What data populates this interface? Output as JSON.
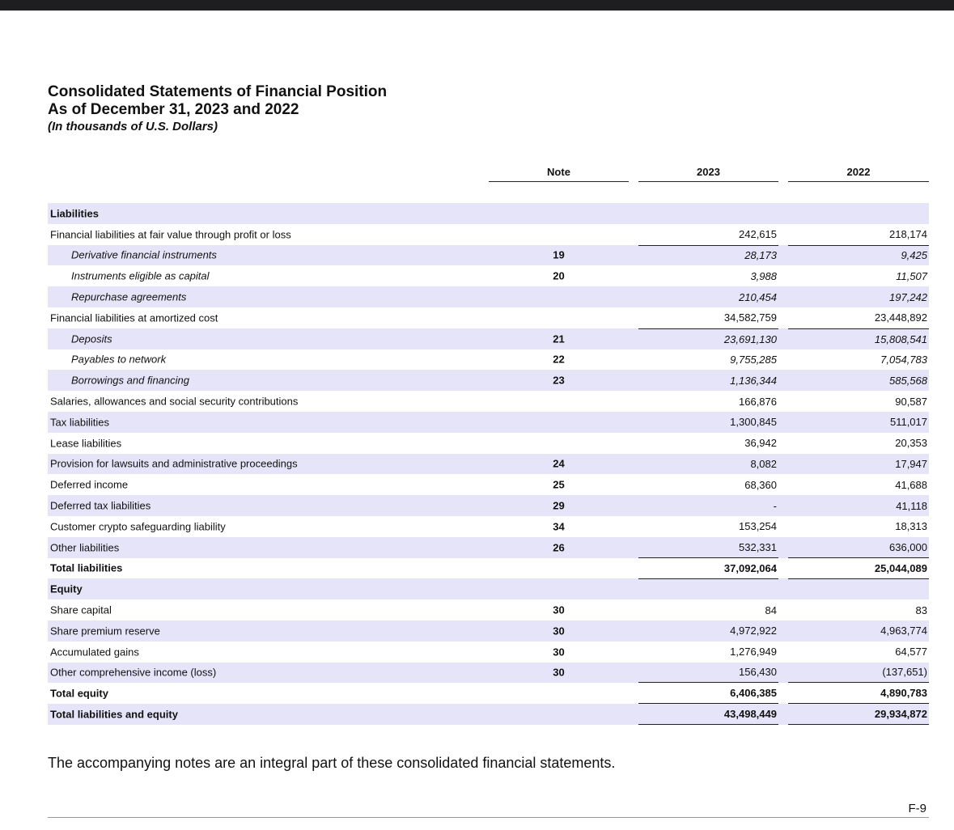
{
  "header": {
    "title": "Consolidated Statements of Financial Position",
    "subtitle": "As of December 31, 2023 and 2022",
    "units": "(In thousands of U.S. Dollars)"
  },
  "columns": {
    "note": "Note",
    "y2023": "2023",
    "y2022": "2022"
  },
  "rows": [
    {
      "label": "Liabilities",
      "note": "",
      "v2023": "",
      "v2022": ""
    },
    {
      "label": "Financial liabilities at fair value through profit or loss",
      "note": "",
      "v2023": "242,615",
      "v2022": "218,174"
    },
    {
      "label": "Derivative financial instruments",
      "note": "19",
      "v2023": "28,173",
      "v2022": "9,425"
    },
    {
      "label": "Instruments eligible as capital",
      "note": "20",
      "v2023": "3,988",
      "v2022": "11,507"
    },
    {
      "label": "Repurchase agreements",
      "note": "",
      "v2023": "210,454",
      "v2022": "197,242"
    },
    {
      "label": "Financial liabilities at amortized cost",
      "note": "",
      "v2023": "34,582,759",
      "v2022": "23,448,892"
    },
    {
      "label": "Deposits",
      "note": "21",
      "v2023": "23,691,130",
      "v2022": "15,808,541"
    },
    {
      "label": "Payables to network",
      "note": "22",
      "v2023": "9,755,285",
      "v2022": "7,054,783"
    },
    {
      "label": "Borrowings and financing",
      "note": "23",
      "v2023": "1,136,344",
      "v2022": "585,568"
    },
    {
      "label": "Salaries, allowances and social security contributions",
      "note": "",
      "v2023": "166,876",
      "v2022": "90,587"
    },
    {
      "label": "Tax liabilities",
      "note": "",
      "v2023": "1,300,845",
      "v2022": "511,017"
    },
    {
      "label": "Lease liabilities",
      "note": "",
      "v2023": "36,942",
      "v2022": "20,353"
    },
    {
      "label": "Provision for lawsuits and administrative proceedings",
      "note": "24",
      "v2023": "8,082",
      "v2022": "17,947"
    },
    {
      "label": "Deferred income",
      "note": "25",
      "v2023": "68,360",
      "v2022": "41,688"
    },
    {
      "label": "Deferred tax liabilities",
      "note": "29",
      "v2023": "-",
      "v2022": "41,118"
    },
    {
      "label": "Customer crypto safeguarding liability",
      "note": "34",
      "v2023": "153,254",
      "v2022": "18,313"
    },
    {
      "label": "Other liabilities",
      "note": "26",
      "v2023": "532,331",
      "v2022": "636,000"
    },
    {
      "label": "Total liabilities",
      "note": "",
      "v2023": "37,092,064",
      "v2022": "25,044,089"
    },
    {
      "label": "Equity",
      "note": "",
      "v2023": "",
      "v2022": ""
    },
    {
      "label": "Share capital",
      "note": "30",
      "v2023": "84",
      "v2022": "83"
    },
    {
      "label": "Share premium reserve",
      "note": "30",
      "v2023": "4,972,922",
      "v2022": "4,963,774"
    },
    {
      "label": "Accumulated gains",
      "note": "30",
      "v2023": "1,276,949",
      "v2022": "64,577"
    },
    {
      "label": "Other comprehensive income (loss)",
      "note": "30",
      "v2023": "156,430",
      "v2022": "(137,651)"
    },
    {
      "label": "Total equity",
      "note": "",
      "v2023": "6,406,385",
      "v2022": "4,890,783"
    },
    {
      "label": "Total liabilities and equity",
      "note": "",
      "v2023": "43,498,449",
      "v2022": "29,934,872"
    }
  ],
  "footer": {
    "note": "The accompanying notes are an integral part of these consolidated financial statements.",
    "page": "F-9"
  }
}
